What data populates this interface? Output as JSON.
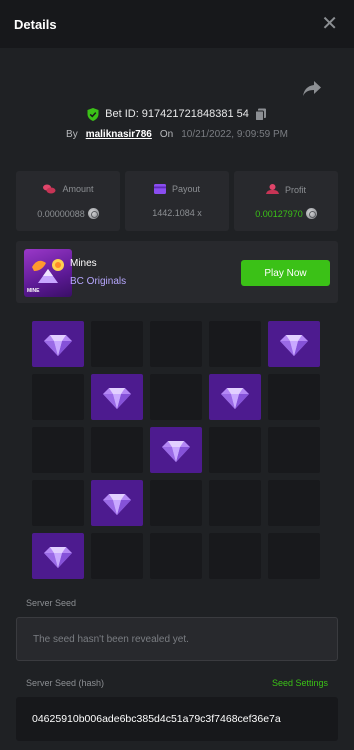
{
  "header": {
    "title": "Details",
    "close_symbol": "✕"
  },
  "bet": {
    "bet_id": "Bet ID: 917421721848381 54",
    "by_label": "By",
    "username": "maliknasir786",
    "on_label": "On",
    "date": "10/21/2022, 9:09:59 PM"
  },
  "stats": {
    "amount": {
      "label": "Amount",
      "value": "0.00000088"
    },
    "payout": {
      "label": "Payout",
      "value": "1442.1084 x"
    },
    "profit": {
      "label": "Profit",
      "value": "0.00127970"
    }
  },
  "game": {
    "thumb_label": "MINE",
    "name": "Mines",
    "provider": "BC Originals",
    "play_label": "Play Now"
  },
  "board": {
    "rows": [
      [
        "gem",
        "empty",
        "empty",
        "empty",
        "gem"
      ],
      [
        "empty",
        "gem",
        "empty",
        "gem",
        "empty"
      ],
      [
        "empty",
        "empty",
        "gem",
        "empty",
        "empty"
      ],
      [
        "empty",
        "gem",
        "empty",
        "empty",
        "empty"
      ],
      [
        "gem",
        "empty",
        "empty",
        "empty",
        "empty"
      ]
    ]
  },
  "seeds": {
    "server_seed_label": "Server Seed",
    "server_seed_value": "The seed hasn't been revealed yet.",
    "server_hash_label": "Server Seed (hash)",
    "seed_settings_label": "Seed Settings",
    "server_hash_value": "04625910b006ade6bc385d4c51a79c3f7468cef36e7a"
  },
  "colors": {
    "accent_green": "#3bc117",
    "gem_purple": "#4d1b8f",
    "background": "#1f2124"
  },
  "icons": [
    "close-icon",
    "share-icon",
    "shield-check-icon",
    "copy-icon",
    "amount-icon",
    "payout-icon",
    "profit-icon",
    "coin-icon",
    "gem-icon"
  ]
}
